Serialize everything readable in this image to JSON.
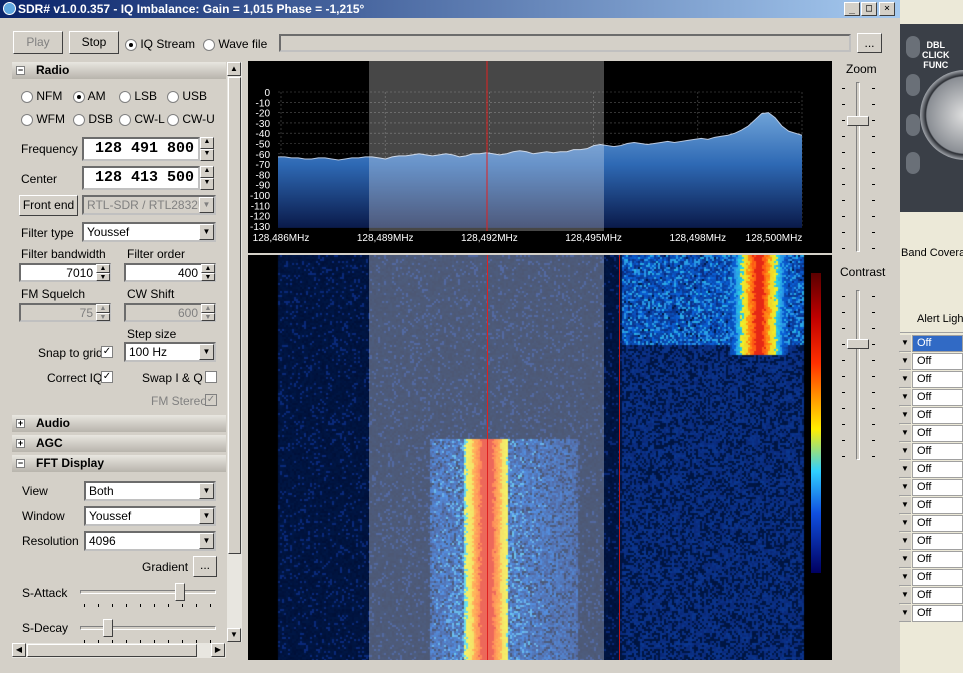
{
  "window": {
    "title": "SDR# v1.0.0.357 - IQ Imbalance: Gain = 1,015 Phase = -1,215°"
  },
  "toolbar": {
    "play": "Play",
    "stop": "Stop",
    "iq_stream": "IQ Stream",
    "wave_file": "Wave file",
    "browse": "..."
  },
  "radio": {
    "section": "Radio",
    "modes": [
      "NFM",
      "AM",
      "LSB",
      "USB",
      "WFM",
      "DSB",
      "CW-L",
      "CW-U"
    ],
    "selected_mode": "AM",
    "frequency_label": "Frequency",
    "frequency": "128 491 800",
    "center_label": "Center",
    "center": "128 413 500",
    "front_end_button": "Front end",
    "front_end": "RTL-SDR / RTL2832U",
    "filter_type_label": "Filter type",
    "filter_type": "Youssef",
    "filter_bandwidth_label": "Filter bandwidth",
    "filter_bandwidth": "7010",
    "filter_order_label": "Filter order",
    "filter_order": "400",
    "fm_squelch_label": "FM Squelch",
    "fm_squelch": "75",
    "cw_shift_label": "CW Shift",
    "cw_shift": "600",
    "step_size_label": "Step size",
    "snap_label": "Snap to grid",
    "step_size": "100 Hz",
    "correct_iq_label": "Correct IQ",
    "swap_iq_label": "Swap I & Q",
    "fm_stereo_label": "FM Stereo"
  },
  "sections": {
    "audio": "Audio",
    "agc": "AGC",
    "fft": "FFT Display"
  },
  "fft": {
    "view_label": "View",
    "view": "Both",
    "window_label": "Window",
    "window": "Youssef",
    "resolution_label": "Resolution",
    "resolution": "4096",
    "gradient_label": "Gradient",
    "gradient_button": "...",
    "s_attack_label": "S-Attack",
    "s_decay_label": "S-Decay",
    "s_attack": 0.75,
    "s_decay": 0.18
  },
  "side": {
    "zoom": "Zoom",
    "contrast": "Contrast",
    "zoom_level": 0.8,
    "contrast_level": 0.7
  },
  "spectrum": {
    "db_labels": [
      "0",
      "-10",
      "-20",
      "-30",
      "-40",
      "-50",
      "-60",
      "-70",
      "-80",
      "-90",
      "-100",
      "-110",
      "-120",
      "-130"
    ],
    "freq_labels": [
      "128,486MHz",
      "128,489MHz",
      "128,492MHz",
      "128,495MHz",
      "128,498MHz",
      "128,500MHz"
    ],
    "levels_db": [
      -63,
      -63,
      -64,
      -64,
      -65,
      -65,
      -64,
      -64,
      -65,
      -66,
      -65,
      -64,
      -64,
      -63,
      -63,
      -64,
      -65,
      -63,
      -62,
      -62,
      -61,
      -60,
      -61,
      -62,
      -61,
      -60,
      -61,
      -63,
      -62,
      -60,
      -60,
      -59,
      -60,
      -61,
      -60,
      -58,
      -57,
      -58,
      -60,
      -59,
      -58,
      -59,
      -58,
      -58,
      -56,
      -56,
      -55,
      -52,
      -51,
      -52,
      -53,
      -52,
      -50,
      -49,
      -50,
      -51,
      -50,
      -49,
      -48,
      -49,
      -48,
      -47,
      -46,
      -45,
      -46,
      -44,
      -43,
      -42,
      -40,
      -37,
      -33,
      -27,
      -21,
      -20,
      -25,
      -33,
      -38,
      -40,
      -42
    ]
  },
  "right_panel": {
    "dbl_click": "DBL\nCLICK\nFUNC",
    "band_coverage": "Band Covera",
    "alert_header": "Alert Ligh",
    "rows": [
      "Off",
      "Off",
      "Off",
      "Off",
      "Off",
      "Off",
      "Off",
      "Off",
      "Off",
      "Off",
      "Off",
      "Off",
      "Off",
      "Off",
      "Off",
      "Off"
    ]
  }
}
